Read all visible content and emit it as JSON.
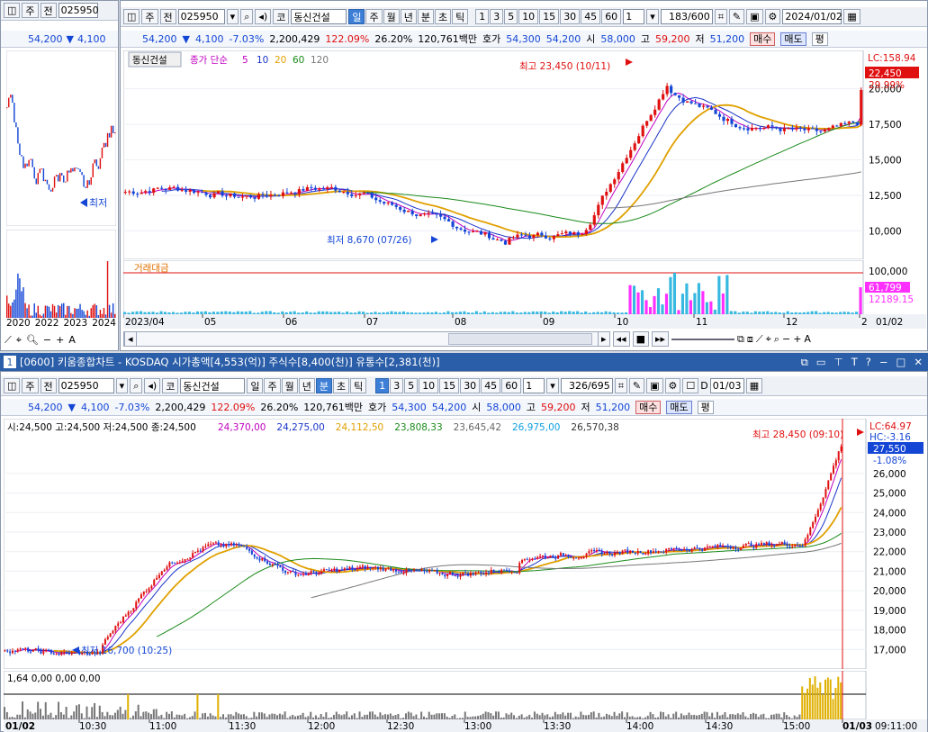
{
  "left_panel": {
    "code": "025950",
    "jong": "주",
    "jeon": "전",
    "price": "54,200",
    "change": "4,100",
    "down_arrow": "▼",
    "low_label": "최저",
    "x_ticks": [
      "2020",
      "2022",
      "2023",
      "2024"
    ]
  },
  "top": {
    "code": "025950",
    "jong": "주",
    "jeon": "전",
    "stock_kind": "코",
    "stock_name": "동신건설",
    "periods": [
      "일",
      "주",
      "월",
      "년",
      "분",
      "초",
      "틱"
    ],
    "selected_period": "일",
    "numbers": [
      "1",
      "3",
      "5",
      "10",
      "15",
      "30",
      "45",
      "60"
    ],
    "count_value": "1",
    "bars": "183/600",
    "date": "2024/01/02",
    "info": {
      "price": "54,200",
      "arrow": "▼",
      "change": "4,100",
      "pct": "-7.03%",
      "volume": "2,200,429",
      "vol_ratio": "122.09%",
      "turnover": "26.20%",
      "amount": "120,761백만",
      "hoga_label": "호가",
      "ask": "54,300",
      "bid": "54,200",
      "open_label": "시",
      "open": "58,000",
      "high_label": "고",
      "high": "59,200",
      "low_label": "저",
      "low": "51,200",
      "buy": "매수",
      "sell": "매도",
      "pyeong": "평"
    },
    "legend": {
      "name": "동신건설",
      "ma_title": "종가 단순",
      "ma": [
        "5",
        "10",
        "20",
        "60",
        "120"
      ]
    },
    "annot_high": "최고 23,450 (10/11)",
    "annot_low": "최저 8,670 (07/26)",
    "badges": {
      "lc": "LC:158.94",
      "price": "22,450",
      "pct": "29.99%",
      "vol": "61,799",
      "vol2": "12189.15"
    },
    "y_ticks": [
      "20,000",
      "17,500",
      "15,000",
      "12,500",
      "10,000"
    ],
    "vol_title": "거래대금",
    "vol_tick": "100,000",
    "x_ticks": [
      "2023/04",
      "05",
      "06",
      "07",
      "08",
      "09",
      "10",
      "11",
      "12",
      "2"
    ],
    "x_corner": "01/02"
  },
  "bottom": {
    "window_title": "[0600] 키움종합차트 - KOSDAQ 시가총액[4,553(억)] 주식수[8,400(천)] 유통수[2,381(천)]",
    "win_no": "1",
    "code": "025950",
    "jong": "주",
    "jeon": "전",
    "stock_kind": "코",
    "stock_name": "동신건설",
    "periods": [
      "일",
      "주",
      "월",
      "년",
      "분",
      "초",
      "틱"
    ],
    "selected_period": "분",
    "numbers": [
      "1",
      "3",
      "5",
      "10",
      "15",
      "30",
      "45",
      "60"
    ],
    "selected_number": "1",
    "count_value": "1",
    "bars": "326/695",
    "date": "01/03",
    "d_label": "D",
    "info": {
      "price": "54,200",
      "arrow": "▼",
      "change": "4,100",
      "pct": "-7.03%",
      "volume": "2,200,429",
      "vol_ratio": "122.09%",
      "turnover": "26.20%",
      "amount": "120,761백만",
      "hoga_label": "호가",
      "ask": "54,300",
      "bid": "54,200",
      "open_label": "시",
      "open": "58,000",
      "high_label": "고",
      "high": "59,200",
      "low_label": "저",
      "low": "51,200",
      "buy": "매수",
      "sell": "매도",
      "pyeong": "평"
    },
    "ohlc_line": "시:24,500 고:24,500 저:24,500 종:24,500",
    "ma_values": [
      {
        "v": "24,370,00",
        "c": "#c000c0"
      },
      {
        "v": "24,275,00",
        "c": "#1a34c8"
      },
      {
        "v": "24,112,50",
        "c": "#e0a000"
      },
      {
        "v": "23,808,33",
        "c": "#1a8a1a"
      },
      {
        "v": "23,645,42",
        "c": "#666666"
      },
      {
        "v": "26,975,00",
        "c": "#10a0e0"
      },
      {
        "v": "26,570,38",
        "c": "#333333"
      }
    ],
    "annot_high": "최고 28,450 (09:10)",
    "annot_low": "최저 16,700 (10:25)",
    "badges": {
      "lc": "LC:64.97",
      "hc": "HC:-3.16",
      "price": "27,550",
      "pct": "-1.08%"
    },
    "y_ticks": [
      "26,000",
      "25,000",
      "24,000",
      "23,000",
      "22,000",
      "21,000",
      "20,000",
      "19,000",
      "18,000",
      "17,000"
    ],
    "vol_line": "1,64 0,00 0,00 0,00",
    "x_ticks": [
      "10:30",
      "11:00",
      "11:30",
      "12:00",
      "12:30",
      "13:00",
      "13:30",
      "14:00",
      "14:30",
      "15:00",
      "01/03"
    ],
    "x_start": "01/02",
    "x_corner": "09:11:00"
  },
  "colors": {
    "up": "#e01010",
    "down": "#1446d6",
    "ma5": "#c000c0",
    "ma10": "#1a34c8",
    "ma20": "#e0a000",
    "ma60": "#1a8a1a",
    "ma120": "#777777",
    "vol_hl": "#ff30ff"
  }
}
